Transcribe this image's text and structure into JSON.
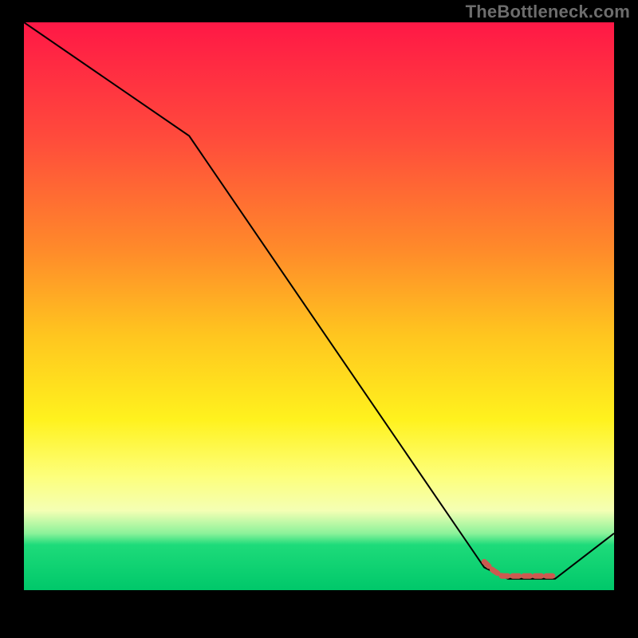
{
  "watermark": "TheBottleneck.com",
  "chart_data": {
    "type": "line",
    "title": "",
    "xlabel": "",
    "ylabel": "",
    "x_range": [
      0,
      100
    ],
    "y_range": [
      0,
      100
    ],
    "grid": false,
    "legend": false,
    "background": {
      "kind": "rainbow-vertical",
      "stops": [
        {
          "pct": 0,
          "color": "#ff1846"
        },
        {
          "pct": 20,
          "color": "#ff4a3c"
        },
        {
          "pct": 40,
          "color": "#ff8a2a"
        },
        {
          "pct": 55,
          "color": "#ffc51f"
        },
        {
          "pct": 70,
          "color": "#fff21e"
        },
        {
          "pct": 80,
          "color": "#fdff7c"
        },
        {
          "pct": 86,
          "color": "#f4ffb4"
        },
        {
          "pct": 90,
          "color": "#8cf29a"
        },
        {
          "pct": 92,
          "color": "#1edb7a"
        },
        {
          "pct": 100,
          "color": "#00c86a"
        }
      ]
    },
    "series": [
      {
        "name": "bottleneck-curve",
        "color": "#000000",
        "stroke_width": 2,
        "x": [
          0,
          28,
          78,
          82,
          90,
          100
        ],
        "values": [
          100,
          80,
          4,
          2,
          2,
          10
        ]
      }
    ],
    "annotations": [
      {
        "name": "selected-range-marker",
        "kind": "dashed-segment",
        "color": "#cc5a50",
        "stroke_width": 7,
        "dash": "8 6",
        "points_x": [
          78,
          79.5,
          81,
          90
        ],
        "points_y": [
          5,
          3.5,
          2.5,
          2.5
        ]
      }
    ]
  }
}
